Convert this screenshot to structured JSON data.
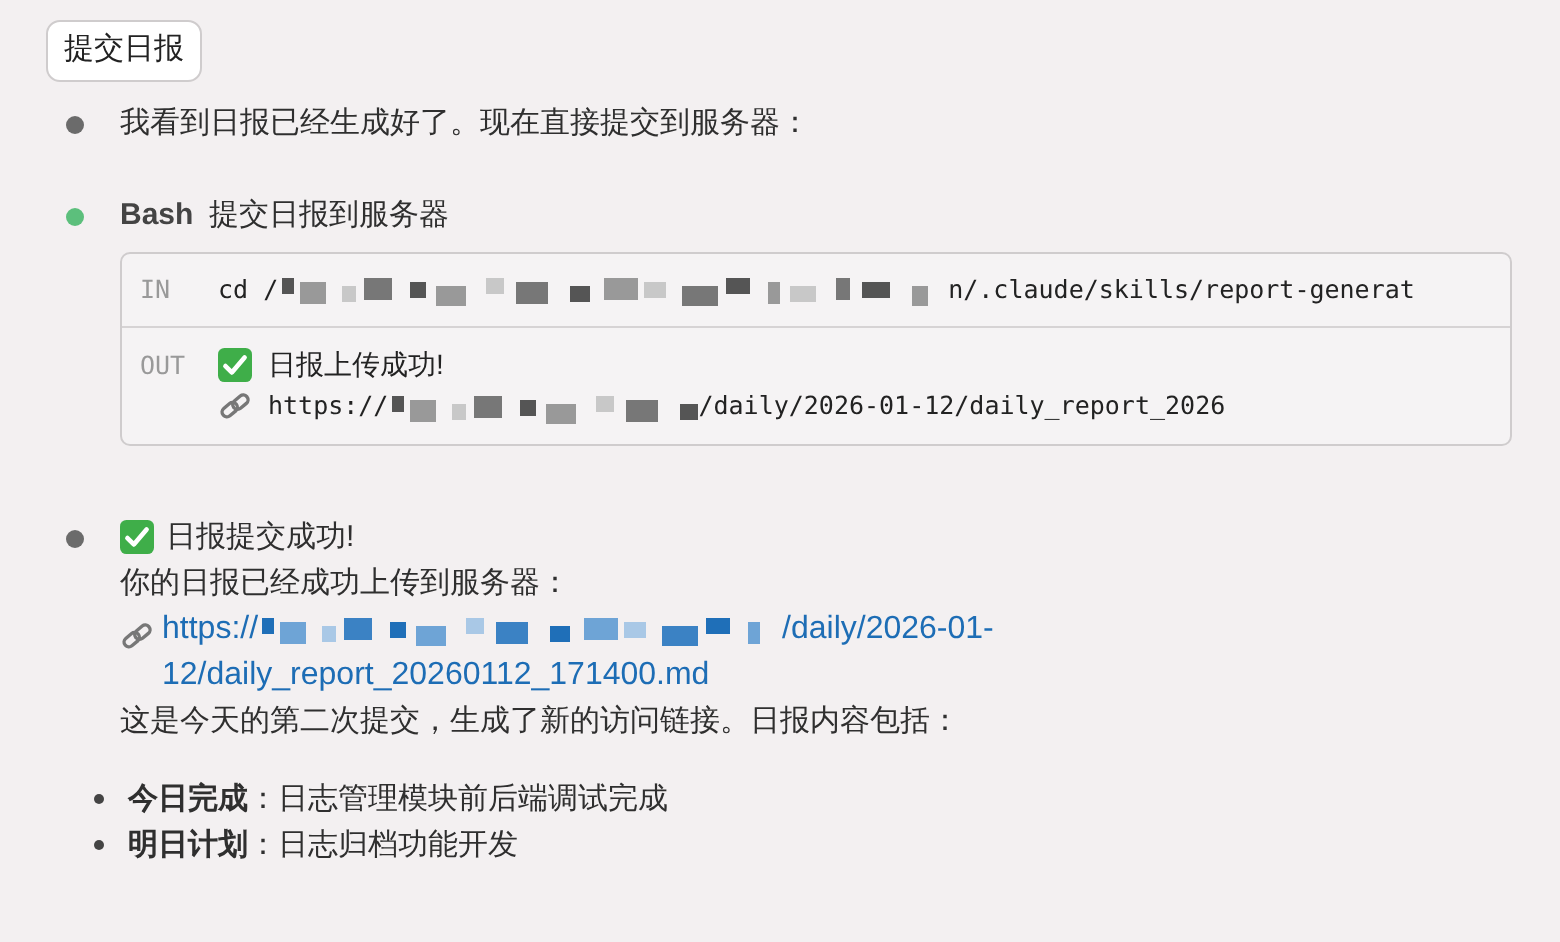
{
  "header_button": {
    "label": "提交日报"
  },
  "messages": [
    {
      "kind": "text",
      "color": "#6b6b6b",
      "text": "我看到日报已经生成好了。现在直接提交到服务器："
    },
    {
      "kind": "tool",
      "color": "#5cbf7c",
      "tool": "Bash",
      "description": "提交日报到服务器",
      "input": {
        "label": "IN",
        "prefix": "cd /",
        "suffix": "n/.claude/skills/report-generat"
      },
      "output": {
        "label": "OUT",
        "message": "日报上传成功!",
        "url_prefix": "https://",
        "url_suffix": "/daily/2026-01-12/daily_report_2026"
      }
    },
    {
      "kind": "result",
      "color": "#6b6b6b",
      "title": "日报提交成功!",
      "intro": "你的日报已经成功上传到服务器：",
      "link": {
        "prefix": "https://",
        "line_1_suffix": "/daily/2026-01-",
        "line_2": "12/daily_report_20260112_171400.md"
      },
      "summary": "这是今天的第二次提交，生成了新的访问链接。日报内容包括：",
      "items": [
        {
          "label": "今日完成",
          "text": "：日志管理模块前后端调试完成"
        },
        {
          "label": "明日计划",
          "text": "：日志归档功能开发"
        }
      ]
    }
  ]
}
